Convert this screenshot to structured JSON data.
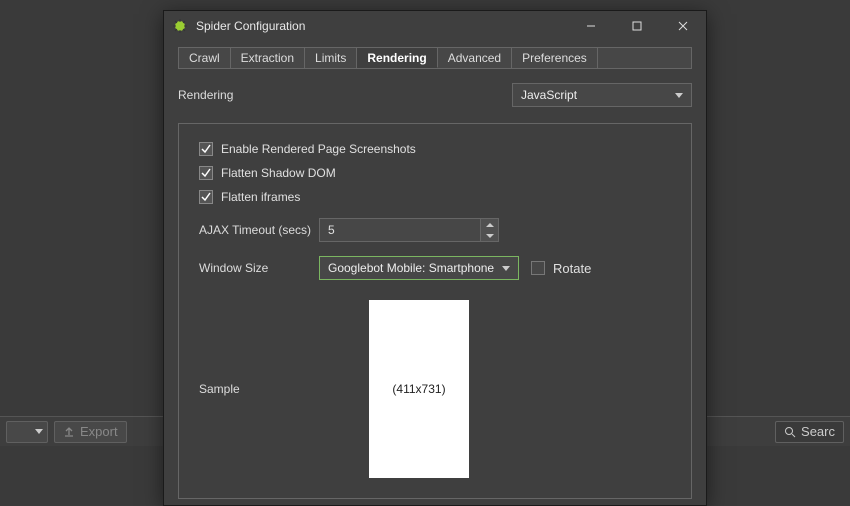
{
  "bg": {
    "export": "Export",
    "search": "Searc"
  },
  "window": {
    "title": "Spider Configuration"
  },
  "tabs": [
    "Crawl",
    "Extraction",
    "Limits",
    "Rendering",
    "Advanced",
    "Preferences"
  ],
  "active_tab": "Rendering",
  "rendering": {
    "label": "Rendering",
    "value": "JavaScript"
  },
  "checks": {
    "screenshots": "Enable Rendered Page Screenshots",
    "shadow": "Flatten Shadow DOM",
    "iframes": "Flatten iframes"
  },
  "ajax": {
    "label": "AJAX Timeout (secs)",
    "value": "5"
  },
  "winsize": {
    "label": "Window Size",
    "value": "Googlebot Mobile: Smartphone",
    "rotate": "Rotate"
  },
  "sample": {
    "label": "Sample",
    "dim": "(411x731)"
  }
}
